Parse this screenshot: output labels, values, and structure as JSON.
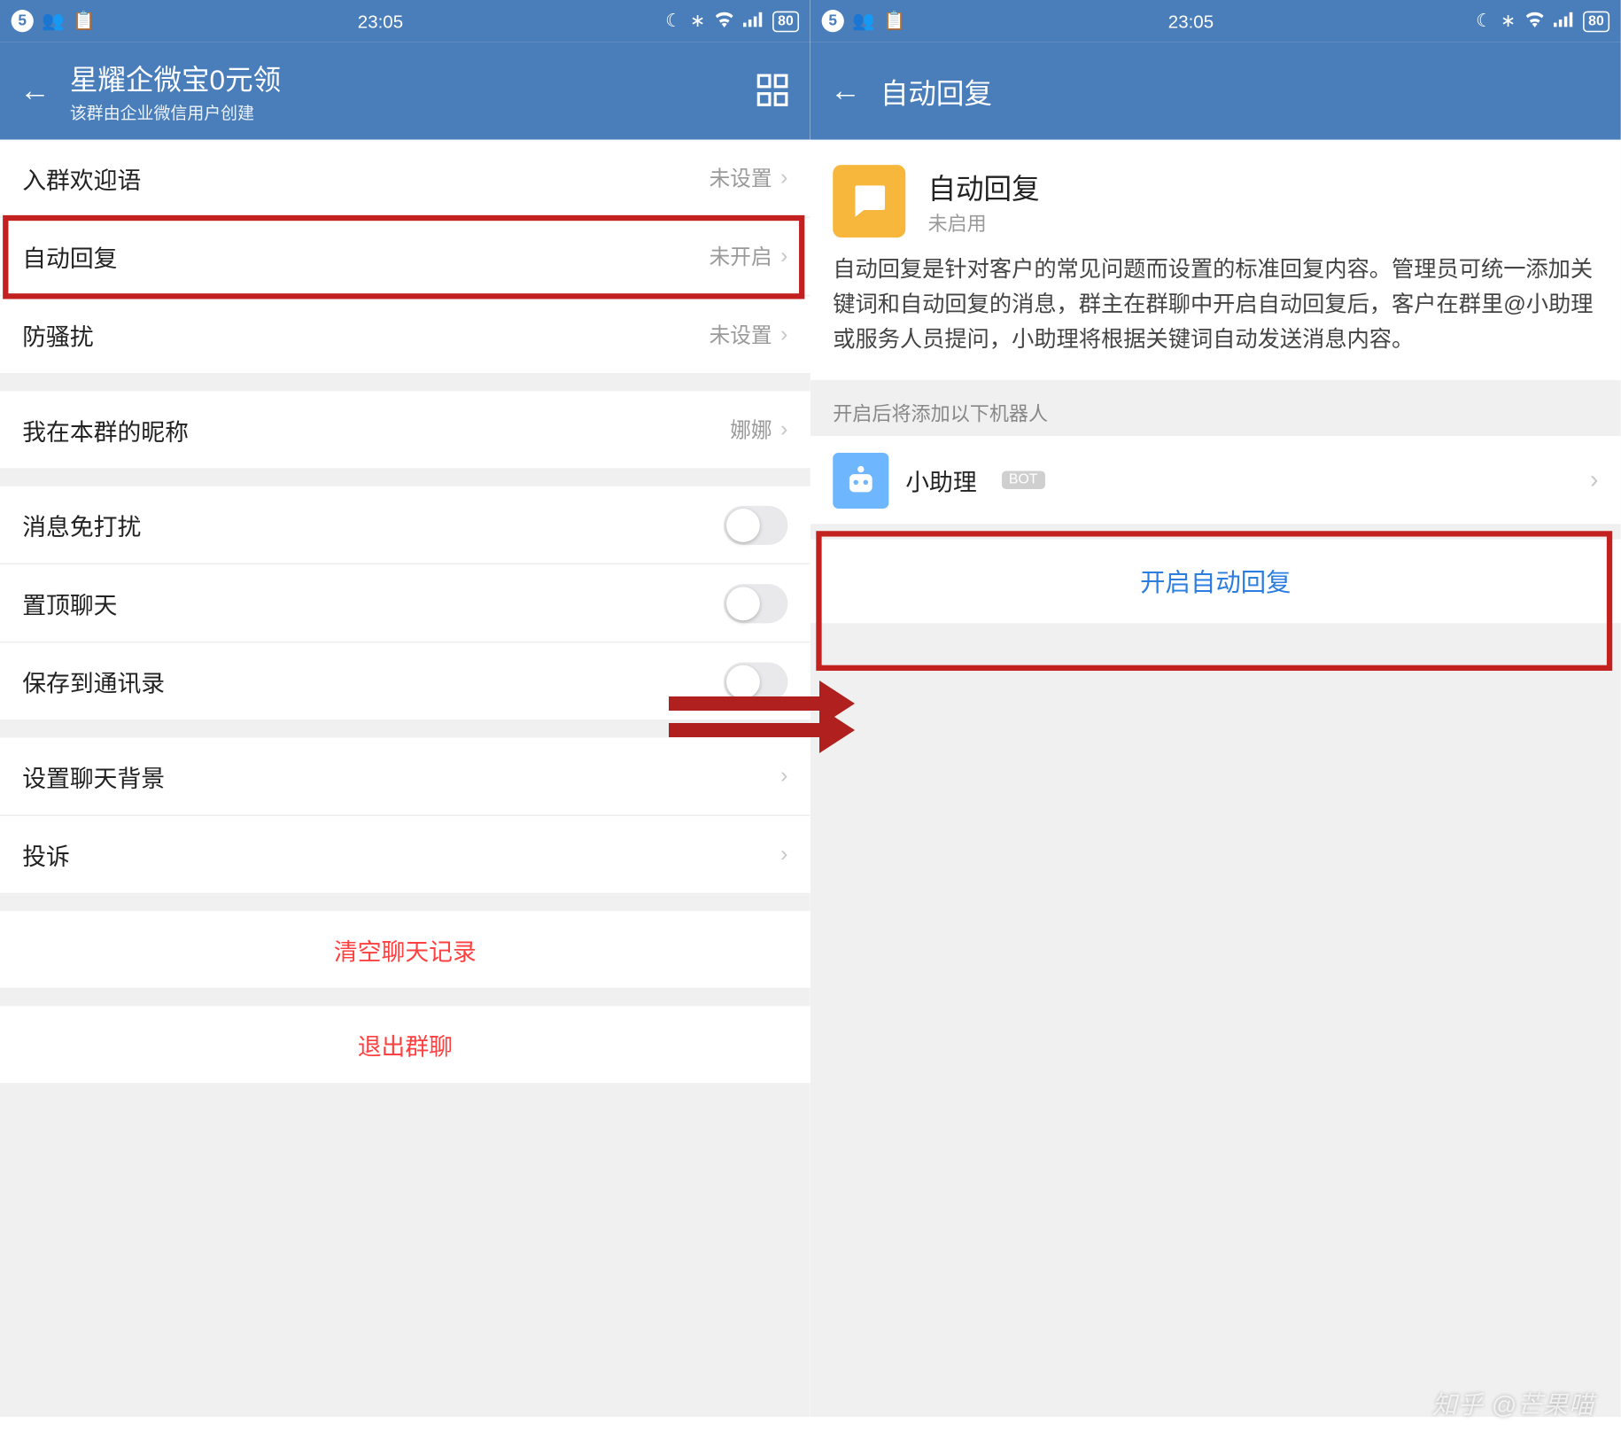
{
  "statusbar": {
    "badge": "5",
    "time": "23:05",
    "battery": "80"
  },
  "left": {
    "nav": {
      "title": "星耀企微宝0元领",
      "subtitle": "该群由企业微信用户创建"
    },
    "rows": {
      "welcome": {
        "label": "入群欢迎语",
        "value": "未设置"
      },
      "autoreply": {
        "label": "自动回复",
        "value": "未开启"
      },
      "antispam": {
        "label": "防骚扰",
        "value": "未设置"
      },
      "nickname": {
        "label": "我在本群的昵称",
        "value": "娜娜"
      },
      "mute": {
        "label": "消息免打扰"
      },
      "pin": {
        "label": "置顶聊天"
      },
      "savecontacts": {
        "label": "保存到通讯录"
      },
      "bg": {
        "label": "设置聊天背景"
      },
      "report": {
        "label": "投诉"
      },
      "clear": {
        "label": "清空聊天记录"
      },
      "leave": {
        "label": "退出群聊"
      }
    }
  },
  "right": {
    "nav": {
      "title": "自动回复"
    },
    "feature": {
      "title": "自动回复",
      "status": "未启用"
    },
    "desc": "自动回复是针对客户的常见问题而设置的标准回复内容。管理员可统一添加关键词和自动回复的消息，群主在群聊中开启自动回复后，客户在群里@小助理或服务人员提问，小助理将根据关键词自动发送消息内容。",
    "section_head": "开启后将添加以下机器人",
    "bot": {
      "name": "小助理",
      "tag": "BOT"
    },
    "enable": "开启自动回复"
  },
  "watermark": "知乎 @芒果喵"
}
